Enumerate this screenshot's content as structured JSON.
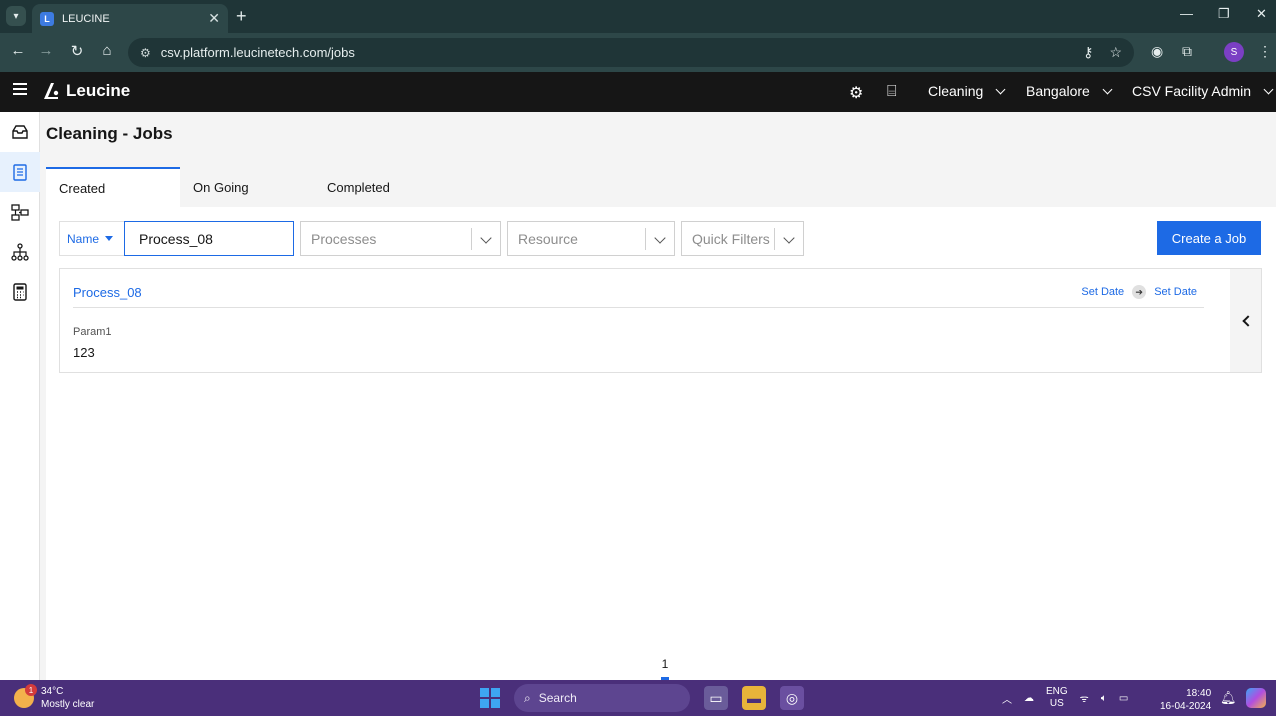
{
  "browser": {
    "tab_title": "LEUCINE",
    "url": "csv.platform.leucinetech.com/jobs",
    "profile_initial": "S"
  },
  "header": {
    "logo_text": "Leucine",
    "use_case": "Cleaning",
    "facility": "Bangalore",
    "role": "CSV Facility Admin"
  },
  "page": {
    "title": "Cleaning - Jobs",
    "tabs": [
      {
        "label": "Created",
        "active": true
      },
      {
        "label": "On Going",
        "active": false
      },
      {
        "label": "Completed",
        "active": false
      }
    ]
  },
  "filters": {
    "field_selector": "Name",
    "search_value": "Process_08",
    "processes_placeholder": "Processes",
    "resource_placeholder": "Resource",
    "quick_filters_placeholder": "Quick Filters",
    "create_button": "Create a Job"
  },
  "jobs": [
    {
      "name": "Process_08",
      "start_date": "Set Date",
      "end_date": "Set Date",
      "param_label": "Param1",
      "param_value": "123"
    }
  ],
  "pagination": {
    "current_page": "1"
  },
  "taskbar": {
    "temperature": "34°C",
    "weather": "Mostly clear",
    "weather_badge": "1",
    "search_label": "Search",
    "lang_line1": "ENG",
    "lang_line2": "US",
    "time": "18:40",
    "date": "16-04-2024"
  },
  "colors": {
    "accent": "#1d6ae5",
    "appbar": "#161616",
    "taskbar": "#4a2f7a"
  }
}
